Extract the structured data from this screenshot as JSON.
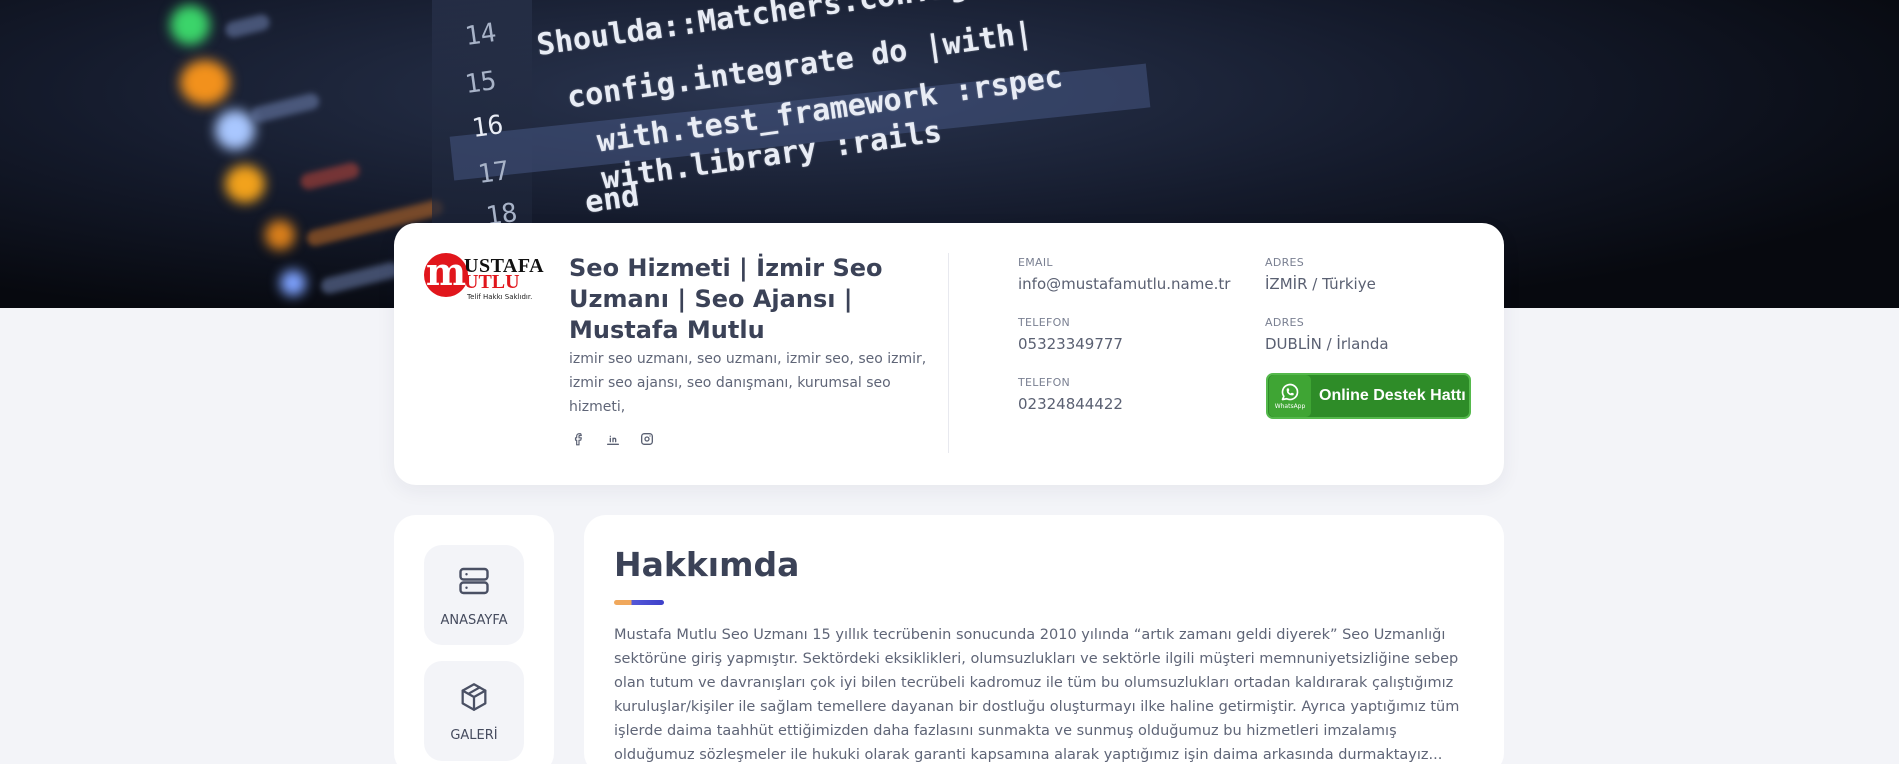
{
  "header": {
    "logo": {
      "mark": "m",
      "line1": "USTAFA",
      "line2": "UTLU",
      "tagline": "Telif Hakkı Saklıdır."
    },
    "title": "Seo Hizmeti | İzmir Seo Uzmanı | Seo Ajansı | Mustafa Mutlu",
    "description": "izmir seo uzmanı, seo uzmanı, izmir seo, seo izmir, izmir seo ajansı, seo danışmanı, kurumsal seo hizmeti,",
    "socials": [
      {
        "icon": "facebook-icon"
      },
      {
        "icon": "linkedin-icon"
      },
      {
        "icon": "instagram-icon"
      }
    ],
    "contacts": {
      "email": {
        "label": "EMAIL",
        "value": "info@mustafamutlu.name.tr"
      },
      "phone1": {
        "label": "TELEFON",
        "value": "05323349777"
      },
      "phone2": {
        "label": "TELEFON",
        "value": "02324844422"
      },
      "address1": {
        "label": "ADRES",
        "value": "İZMİR / Türkiye"
      },
      "address2": {
        "label": "ADRES",
        "value": "DUBLİN / İrlanda"
      }
    },
    "whatsapp_button": {
      "icon_caption": "WhatsApp",
      "label": "Online Destek Hattı",
      "color": "#2e8c28"
    }
  },
  "sidebar": {
    "items": [
      {
        "label": "ANASAYFA",
        "icon": "server-icon"
      },
      {
        "label": "GALERİ",
        "icon": "cube-icon"
      }
    ]
  },
  "about": {
    "heading": "Hakkımda",
    "text": "Mustafa Mutlu Seo Uzmanı 15 yıllık tecrübenin sonucunda 2010 yılında “artık zamanı geldi diyerek” Seo Uzmanlığı sektörüne giriş yapmıştır. Sektördeki eksiklikleri, olumsuzlukları ve sektörle ilgili müşteri memnuniyetsizliğine sebep olan tutum ve davranışları çok iyi bilen tecrübeli kadromuz ile tüm bu olumsuzlukları ortadan kaldırarak çalıştığımız kuruluşlar/kişiler ile sağlam temellere dayanan bir dostluğu oluşturmayı ilke haline getirmiştir. Ayrıca yaptığımız tüm işlerde daima taahhüt ettiğimizden daha fazlasını sunmakta ve sunmuş olduğumuz bu hizmetleri imzalamış olduğumuz sözleşmeler ile hukuki olarak garanti kapsamına alarak yaptığımız işin daima arkasında durmaktayız..."
  },
  "hero": {
    "code_lines": [
      "Shoulda::Matchers.config",
      "config.integrate do |with|",
      "with.test_framework :rspec",
      "with.library :rails",
      "end"
    ],
    "line_numbers": [
      "14",
      "15",
      "16",
      "17",
      "18"
    ]
  }
}
